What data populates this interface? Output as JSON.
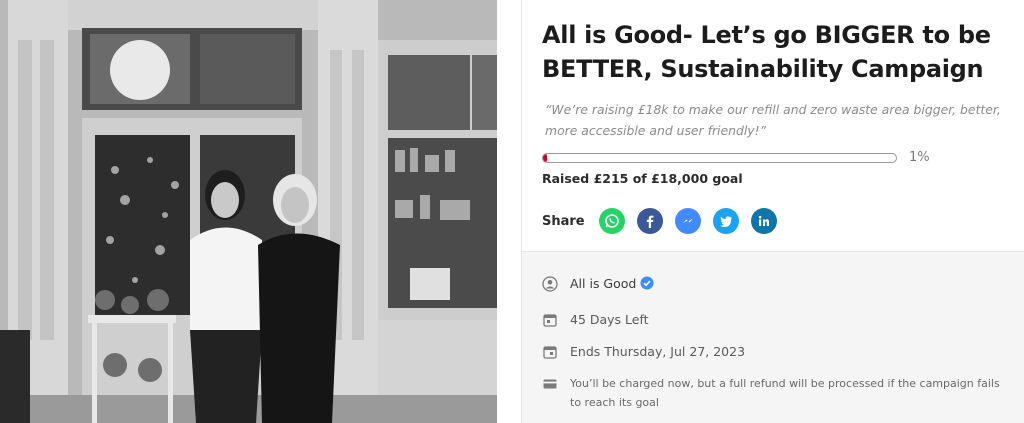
{
  "campaign": {
    "title": "All is Good- Let’s go BIGGER to be BETTER, Sustainability Campaign",
    "quote": "“We’re raising £18k to make our refill and zero waste area bigger, better, more accessible and user friendly!”",
    "progress_percent": 1,
    "progress_label": "1%",
    "raised_text": "Raised £215 of £18,000 goal"
  },
  "share": {
    "label": "Share",
    "networks": [
      {
        "name": "whatsapp",
        "color": "#25d366"
      },
      {
        "name": "facebook",
        "color": "#3b5998"
      },
      {
        "name": "messenger",
        "color": "#448aff"
      },
      {
        "name": "twitter",
        "color": "#1da1f2"
      },
      {
        "name": "linkedin",
        "color": "#0e76a8"
      }
    ]
  },
  "details": {
    "organizer": "All is Good",
    "days_left": "45 Days Left",
    "ends": "Ends Thursday, Jul 27, 2023",
    "charge_note": "You’ll be charged now, but a full refund will be processed if the campaign fails to reach its goal"
  },
  "colors": {
    "progress_fill": "#d0021b",
    "verified_badge": "#3d8bfd"
  }
}
